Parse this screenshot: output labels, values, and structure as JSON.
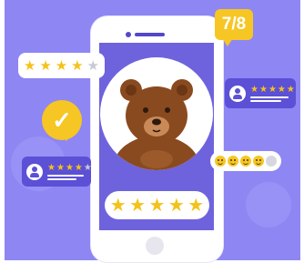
{
  "score": {
    "label": "7/8"
  },
  "bubbles": {
    "top_left": {
      "stars_filled": 4,
      "stars_total": 5
    },
    "review_right": {
      "stars_filled": 5,
      "stars_total": 5
    },
    "review_left": {
      "stars_filled": 4,
      "stars_total": 5
    }
  },
  "rating_bar": {
    "stars_filled": 5,
    "stars_total": 5
  },
  "emoji_rating": {
    "filled": 4,
    "total": 5
  },
  "colors": {
    "background": "#8E86F3",
    "phone_screen": "#6E63DD",
    "accent_yellow": "#F6C624",
    "bear_fur": "#8A4A1F"
  },
  "icons": {
    "check": "check-icon",
    "user": "user-icon",
    "star": "star-icon",
    "bear": "bear-illustration"
  },
  "glyphs": {
    "star": "★",
    "check": "✓"
  }
}
